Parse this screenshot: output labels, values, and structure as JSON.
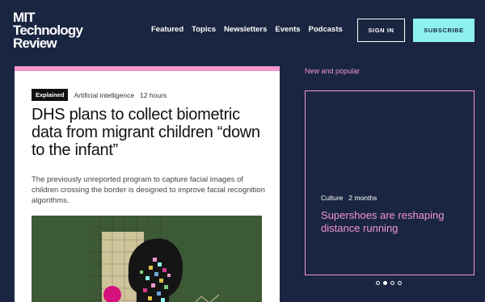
{
  "brand": {
    "line1": "MIT",
    "line2": "Technology",
    "line3": "Review"
  },
  "nav": [
    {
      "label": "Featured"
    },
    {
      "label": "Topics"
    },
    {
      "label": "Newsletters"
    },
    {
      "label": "Events"
    },
    {
      "label": "Podcasts"
    }
  ],
  "header": {
    "signin_label": "SIGN IN",
    "subscribe_label": "SUBSCRIBE"
  },
  "article": {
    "badge": "Explained",
    "topic": "Artificial intelligence",
    "age": "12 hours",
    "title": "DHS plans to collect biometric data from migrant children “down to the infant”",
    "dek": "The previously unreported program to capture facial images of children crossing the border is designed to improve facial recognition algorithms."
  },
  "sidebar": {
    "heading": "New and popular",
    "promo": {
      "topic": "Culture",
      "age": "2 months",
      "title": "Supershoes are reshaping distance running"
    }
  },
  "carousel": {
    "count": 4,
    "active": 2
  },
  "colors": {
    "background": "#1a2641",
    "accent_pink": "#f296cd",
    "accent_cyan": "#8ef1ed",
    "hero_green": "#3d5a36"
  }
}
